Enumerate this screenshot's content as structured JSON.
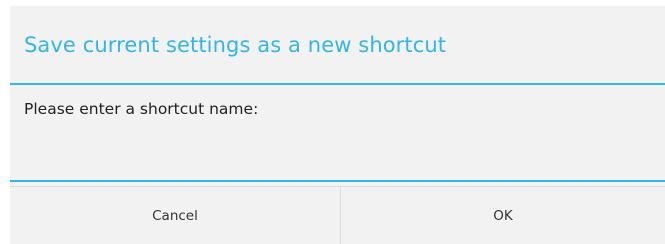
{
  "dialog": {
    "title": "Save current settings as a new shortcut",
    "prompt": "Please enter a shortcut name:",
    "input": {
      "value": "",
      "placeholder": ""
    },
    "buttons": {
      "cancel_label": "Cancel",
      "ok_label": "OK"
    }
  },
  "colors": {
    "accent": "#33b5e5",
    "dialog_background": "#f2f2f2",
    "divider": "#dcdcdc"
  }
}
